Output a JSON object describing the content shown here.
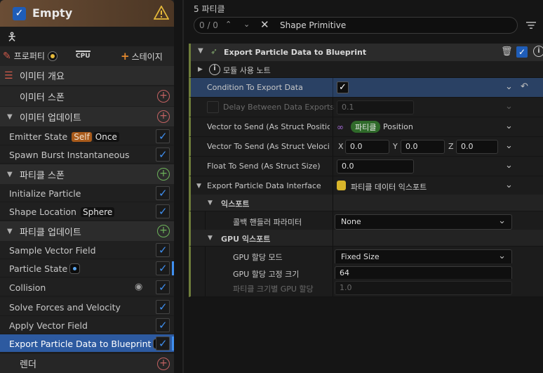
{
  "left": {
    "emitter_name": "Empty",
    "tabs": {
      "properties": "프로퍼티",
      "cpu": "CPU",
      "stage": "스테이지"
    },
    "stages": {
      "emitter_summary": "이미터 개요",
      "emitter_spawn": "이미터 스폰",
      "emitter_update": "이미터 업데이트",
      "particle_spawn": "파티클 스폰",
      "particle_update": "파티클 업데이트",
      "render": "렌더"
    },
    "modules": [
      {
        "name": "Emitter State",
        "chip1": "Self",
        "chip2": "Once"
      },
      {
        "name": "Spawn Burst Instantaneous"
      },
      {
        "name": "Initialize Particle"
      },
      {
        "name": "Shape Location",
        "chip": "Sphere"
      },
      {
        "name": "Sample Vector Field"
      },
      {
        "name": "Particle State"
      },
      {
        "name": "Collision"
      },
      {
        "name": "Solve Forces and Velocity"
      },
      {
        "name": "Apply Vector Field"
      },
      {
        "name": "Export Particle Data to Blueprint"
      }
    ],
    "accent_color": "#3f8ff0",
    "header_color": "#6a4d35"
  },
  "right": {
    "title": "5 파티클",
    "search": {
      "count": "0 / 0",
      "query": "Shape Primitive"
    },
    "module_title": "Export Particle Data to Blueprint",
    "rows": {
      "usage_note": "모듈 사용 노트",
      "condition": "Condition To Export Data",
      "delay": "Delay Between Data Exports",
      "delay_value": "0.1",
      "vector_to_send": "Vector to Send (As Struct Position)",
      "vector_pill": "파티클",
      "vector_after": "Position",
      "velocity": "Vector To Send (As Struct Velocity)",
      "vx_label": "X",
      "vx": "0.0",
      "vy_label": "Y",
      "vy": "0.0",
      "vz_label": "Z",
      "vz": "0.0",
      "float_size": "Float To Send (As Struct Size)",
      "float_value": "0.0",
      "interface": "Export Particle Data Interface",
      "interface_value": "파티클 데이터 익스포트",
      "cat_export": "익스포트",
      "callback": "콜백 핸들러 파라미터",
      "callback_value": "None",
      "cat_gpu": "GPU 익스포트",
      "gpu_mode": "GPU 할당 모드",
      "gpu_mode_value": "Fixed Size",
      "gpu_fixed": "GPU 할당 고정 크기",
      "gpu_fixed_value": "64",
      "gpu_scale": "파티클 크기별 GPU 할당",
      "gpu_scale_value": "1.0"
    },
    "module_accent": "#6e7d3b",
    "highlight_color": "#2a4164"
  }
}
